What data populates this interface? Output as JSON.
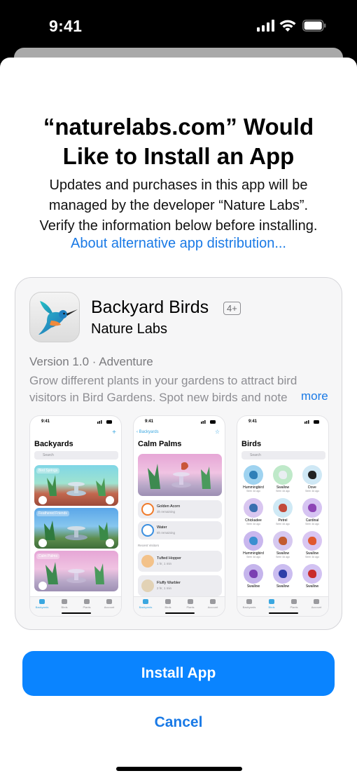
{
  "status_bar": {
    "time": "9:41"
  },
  "dialog": {
    "title_line1": "“naturelabs.com” Would",
    "title_line2": "Like to Install an App",
    "description_line1": "Updates and purchases in this app will be",
    "description_line2": "managed by the developer “Nature Labs”.",
    "description_line3": "Verify the information below before installing.",
    "about_link": "About alternative app distribution..."
  },
  "app": {
    "name": "Backyard Birds",
    "age_rating": "4+",
    "developer": "Nature Labs",
    "version_line": "Version 1.0 · Adventure",
    "description": "Grow different plants in your gardens to attract bird visitors in Bird Gardens. Spot new birds and note",
    "more_label": "more"
  },
  "screenshots": {
    "time": "9:41",
    "tabs": [
      "Backyards",
      "Birds",
      "Plants",
      "Account"
    ],
    "shot1": {
      "title": "Backyards",
      "search": "Search",
      "gardens": [
        "Bird Springs",
        "Feathered Friends",
        "Calm Palms"
      ]
    },
    "shot2": {
      "back": "Backyards",
      "title": "Calm Palms",
      "items": [
        {
          "name": "Golden Acorn",
          "sub": "3h remaining"
        },
        {
          "name": "Water",
          "sub": "8h remaining"
        }
      ],
      "recent_label": "Recent Visitors",
      "visitors": [
        {
          "name": "Tufted Hopper",
          "sub": "1 hr, 1 min"
        },
        {
          "name": "Fluffy Warbler",
          "sub": "2 hr, 1 min"
        }
      ]
    },
    "shot3": {
      "title": "Birds",
      "search": "Search",
      "birds": [
        {
          "name": "Hummingbird",
          "seen": "Seen 4d ago",
          "bg": "#9fd3f0",
          "color": "#2f7fb8"
        },
        {
          "name": "Swallow",
          "seen": "Seen 4d ago",
          "bg": "#bfe9c9",
          "color": "#e9eef2"
        },
        {
          "name": "Dove",
          "seen": "Seen 4d ago",
          "bg": "#cfe8f5",
          "color": "#222222"
        },
        {
          "name": "Chickadee",
          "seen": "Seen 4d ago",
          "bg": "#d9c6f0",
          "color": "#3a6fb0"
        },
        {
          "name": "Petrel",
          "seen": "Seen 4d ago",
          "bg": "#cfe9f5",
          "color": "#c24a3a"
        },
        {
          "name": "Cardinal",
          "seen": "Seen 4d ago",
          "bg": "#d6c4f2",
          "color": "#8d44b6"
        },
        {
          "name": "Hummingbird",
          "seen": "Seen 4d ago",
          "bg": "#c9b7ee",
          "color": "#3b8fd0"
        },
        {
          "name": "Swallow",
          "seen": "Seen 4d ago",
          "bg": "#d6c8f0",
          "color": "#c25b2f"
        },
        {
          "name": "Swallow",
          "seen": "Seen 4d ago",
          "bg": "#d9c6f2",
          "color": "#e0592f"
        },
        {
          "name": "Swallow",
          "seen": "",
          "bg": "#c5b5ec",
          "color": "#7a3fb2"
        },
        {
          "name": "Swallow",
          "seen": "",
          "bg": "#cbbdf0",
          "color": "#2e3fa8"
        },
        {
          "name": "Swallow",
          "seen": "",
          "bg": "#d2c2f2",
          "color": "#c92c2c"
        }
      ]
    }
  },
  "actions": {
    "install_label": "Install App",
    "cancel_label": "Cancel"
  },
  "colors": {
    "accent": "#0a84ff",
    "link": "#1a7ae6"
  }
}
